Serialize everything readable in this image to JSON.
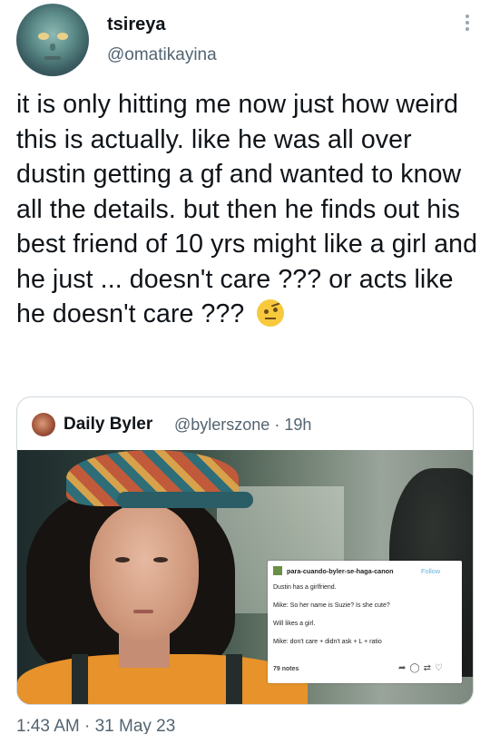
{
  "author": {
    "display_name": "tsireya",
    "handle": "@omatikayina"
  },
  "tweet": {
    "text": "it is only hitting me now just how weird this is actually. like he was all over dustin getting a gf and wanted to know all the details. but then he finds out his best friend of 10 yrs might like a girl and he just ... doesn't care ??? or acts like he doesn't care ???",
    "emoji": "face-with-raised-eyebrow",
    "timestamp": "1:43 AM · 31 May 23"
  },
  "quoted_tweet": {
    "display_name": "Daily Byler",
    "handle_time": "@bylerszone · 19h",
    "media": {
      "tumblr_post": {
        "username": "para-cuando-byler-se-haga-canon",
        "follow_label": "Follow",
        "lines": [
          "Dustin has a girlfriend.",
          "Mike: So her name is Suzie? Is she cute?",
          "Will likes a girl.",
          "Mike: don't care + didn't ask + L + ratio"
        ],
        "notes": "79 notes",
        "icons": [
          "share-icon",
          "comment-icon",
          "reblog-icon",
          "heart-icon"
        ]
      }
    }
  },
  "icons": {
    "more": "more-vertical-icon"
  },
  "colors": {
    "text": "#0f1419",
    "secondary": "#536471",
    "border": "#cfd9de",
    "follow": "#62b0e0"
  }
}
